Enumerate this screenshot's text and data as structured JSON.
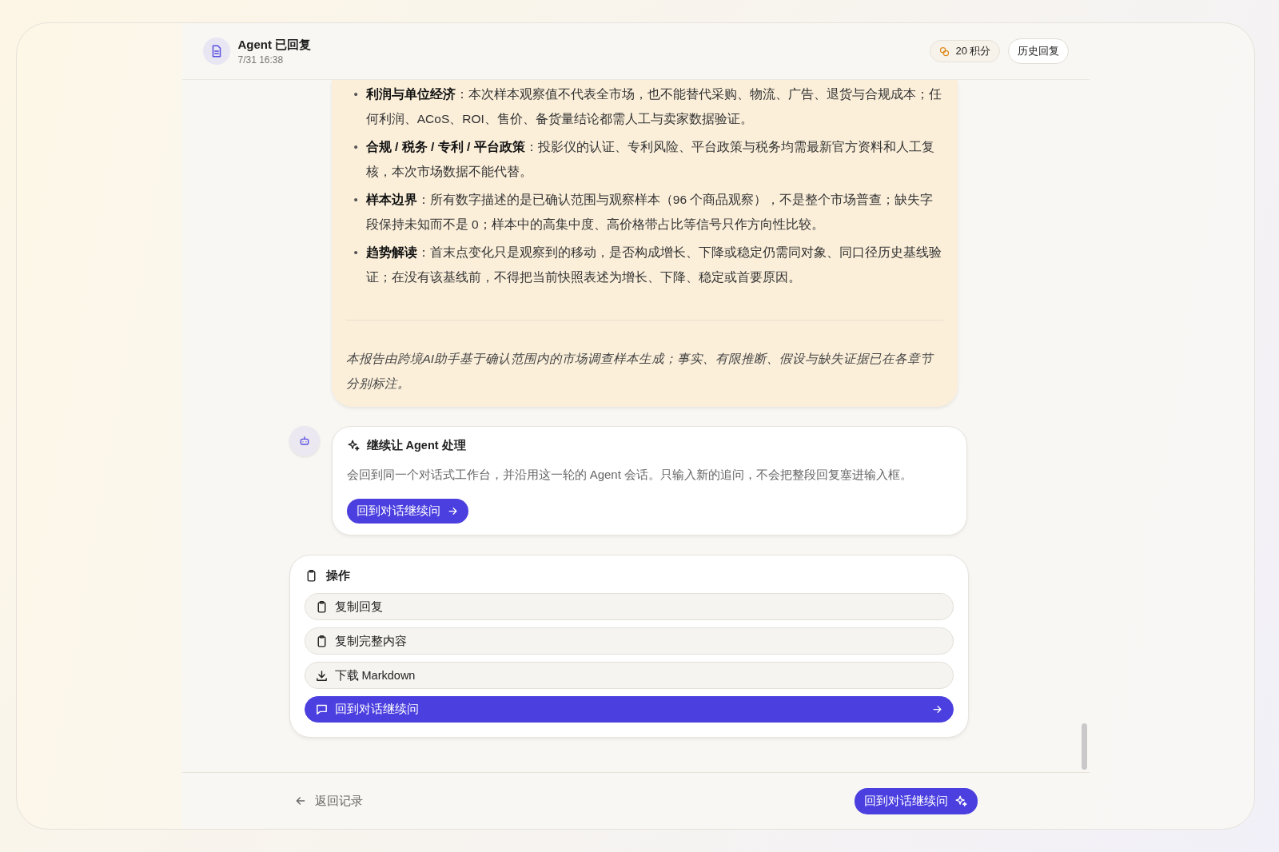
{
  "header": {
    "title": "Agent 已回复",
    "timestamp": "7/31 16:38",
    "credits": "20 积分",
    "history_button": "历史回复"
  },
  "report": {
    "bullets": [
      {
        "marker": "•",
        "text": "**利润与单位经济**：本次样本观察值不代表全市场，也不能替代采购、物流、广告、退货与合规成本；任何利润、ACoS、ROI、售价、备货量结论都需人工与卖家数据验证。"
      },
      {
        "marker": "•",
        "text": "**合规 / 税务 / 专利 / 平台政策**：投影仪的认证、专利风险、平台政策与税务均需最新官方资料和人工复核，本次市场数据不能代替。"
      },
      {
        "marker": "•",
        "text": "**样本边界**：所有数字描述的是已确认范围与观察样本（96 个商品观察），不是整个市场普查；缺失字段保持未知而不是 0；样本中的高集中度、高价格带占比等信号只作方向性比较。"
      },
      {
        "marker": "•",
        "text": "**趋势解读**：首末点变化只是观察到的移动，是否构成增长、下降或稳定仍需同对象、同口径历史基线验证；在没有该基线前，不得把当前快照表述为增长、下降、稳定或首要原因。"
      }
    ],
    "footnote": "本报告由跨境AI助手基于确认范围内的市场调查样本生成；事实、有限推断、假设与缺失证据已在各章节分别标注。"
  },
  "agent_card": {
    "title": "继续让 Agent 处理",
    "description": "会回到同一个对话式工作台，并沿用这一轮的 Agent 会话。只输入新的追问，不会把整段回复塞进输入框。",
    "button": "回到对话继续问"
  },
  "actions": {
    "title": "操作",
    "items": [
      {
        "kind": "copy",
        "label": "复制回复",
        "highlighted": false
      },
      {
        "kind": "copy",
        "label": "复制完整内容",
        "highlighted": false
      },
      {
        "kind": "download",
        "label": "下载 Markdown",
        "highlighted": false
      },
      {
        "kind": "chat",
        "label": "回到对话继续问",
        "highlighted": true
      }
    ]
  },
  "footer": {
    "back_link": "返回记录",
    "continue_button": "回到对话继续问"
  }
}
